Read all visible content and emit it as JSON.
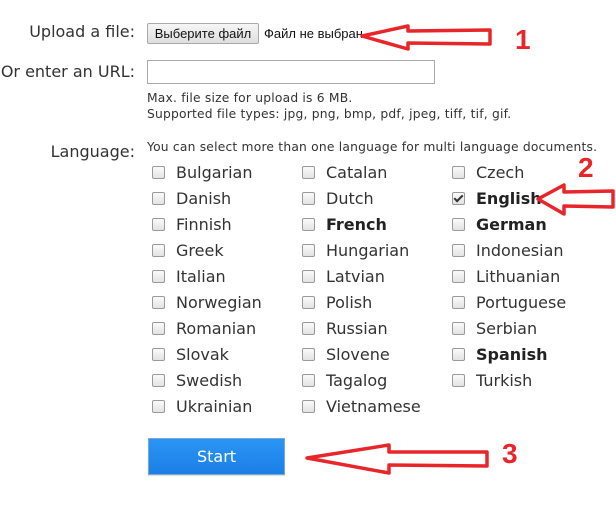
{
  "upload": {
    "label": "Upload a file:",
    "choose_button": "Выберите файл",
    "status": "Файл не выбран"
  },
  "url": {
    "label": "Or enter an URL:",
    "value": "",
    "placeholder": ""
  },
  "hints": {
    "max_size": "Max. file size for upload is 6 MB.",
    "file_types": "Supported file types: jpg, png, bmp, pdf, jpeg, tiff, tif, gif."
  },
  "language": {
    "label": "Language:",
    "hint": "You can select more than one language for multi language documents.",
    "options": [
      {
        "label": "Bulgarian",
        "checked": false,
        "bold": false
      },
      {
        "label": "Catalan",
        "checked": false,
        "bold": false
      },
      {
        "label": "Czech",
        "checked": false,
        "bold": false
      },
      {
        "label": "Danish",
        "checked": false,
        "bold": false
      },
      {
        "label": "Dutch",
        "checked": false,
        "bold": false
      },
      {
        "label": "English",
        "checked": true,
        "bold": true
      },
      {
        "label": "Finnish",
        "checked": false,
        "bold": false
      },
      {
        "label": "French",
        "checked": false,
        "bold": true
      },
      {
        "label": "German",
        "checked": false,
        "bold": true
      },
      {
        "label": "Greek",
        "checked": false,
        "bold": false
      },
      {
        "label": "Hungarian",
        "checked": false,
        "bold": false
      },
      {
        "label": "Indonesian",
        "checked": false,
        "bold": false
      },
      {
        "label": "Italian",
        "checked": false,
        "bold": false
      },
      {
        "label": "Latvian",
        "checked": false,
        "bold": false
      },
      {
        "label": "Lithuanian",
        "checked": false,
        "bold": false
      },
      {
        "label": "Norwegian",
        "checked": false,
        "bold": false
      },
      {
        "label": "Polish",
        "checked": false,
        "bold": false
      },
      {
        "label": "Portuguese",
        "checked": false,
        "bold": false
      },
      {
        "label": "Romanian",
        "checked": false,
        "bold": false
      },
      {
        "label": "Russian",
        "checked": false,
        "bold": false
      },
      {
        "label": "Serbian",
        "checked": false,
        "bold": false
      },
      {
        "label": "Slovak",
        "checked": false,
        "bold": false
      },
      {
        "label": "Slovene",
        "checked": false,
        "bold": false
      },
      {
        "label": "Spanish",
        "checked": false,
        "bold": true
      },
      {
        "label": "Swedish",
        "checked": false,
        "bold": false
      },
      {
        "label": "Tagalog",
        "checked": false,
        "bold": false
      },
      {
        "label": "Turkish",
        "checked": false,
        "bold": false
      },
      {
        "label": "Ukrainian",
        "checked": false,
        "bold": false
      },
      {
        "label": "Vietnamese",
        "checked": false,
        "bold": false
      }
    ]
  },
  "start_button": "Start",
  "annotations": {
    "color": "#e8262a",
    "labels": [
      "1",
      "2",
      "3"
    ]
  }
}
